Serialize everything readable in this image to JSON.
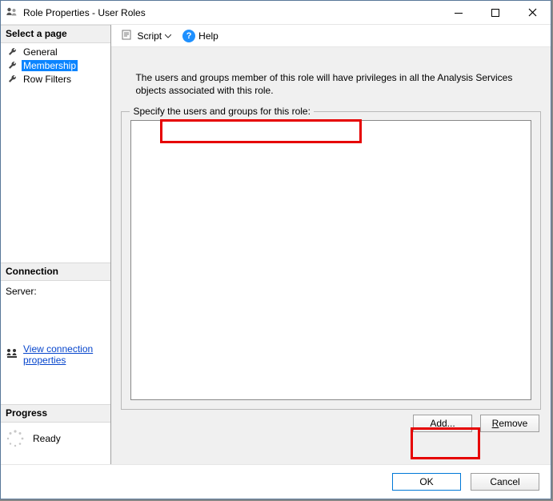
{
  "window": {
    "title": "Role Properties - User Roles"
  },
  "sidebar": {
    "select_header": "Select a page",
    "items": [
      {
        "label": "General",
        "selected": false
      },
      {
        "label": "Membership",
        "selected": true
      },
      {
        "label": "Row Filters",
        "selected": false
      }
    ],
    "connection_header": "Connection",
    "server_label": "Server:",
    "view_connection_link": "View connection properties",
    "progress_header": "Progress",
    "progress_status": "Ready"
  },
  "toolbar": {
    "script_label": "Script",
    "help_label": "Help"
  },
  "main": {
    "description": "The users and groups member of this role will have privileges in all the Analysis Services objects associated with this role.",
    "specify_label": "Specify the users and groups for this role:",
    "add_label": "Add...",
    "remove_label": "Remove"
  },
  "footer": {
    "ok_label": "OK",
    "cancel_label": "Cancel"
  }
}
